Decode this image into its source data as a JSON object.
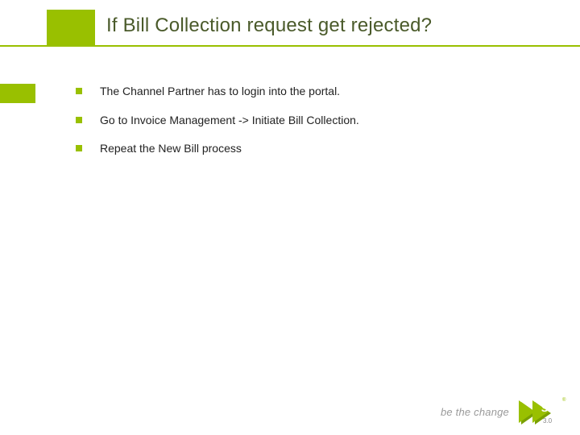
{
  "slide": {
    "title": "If Bill Collection request get rejected?",
    "bullets": [
      "The Channel Partner has to login into the portal.",
      "Go to Invoice Management  -> Initiate Bill Collection.",
      "Repeat the New Bill process"
    ]
  },
  "footer": {
    "tagline": "be the change",
    "logo_text": "sify",
    "logo_reg": "®",
    "logo_sub": "3.0"
  }
}
